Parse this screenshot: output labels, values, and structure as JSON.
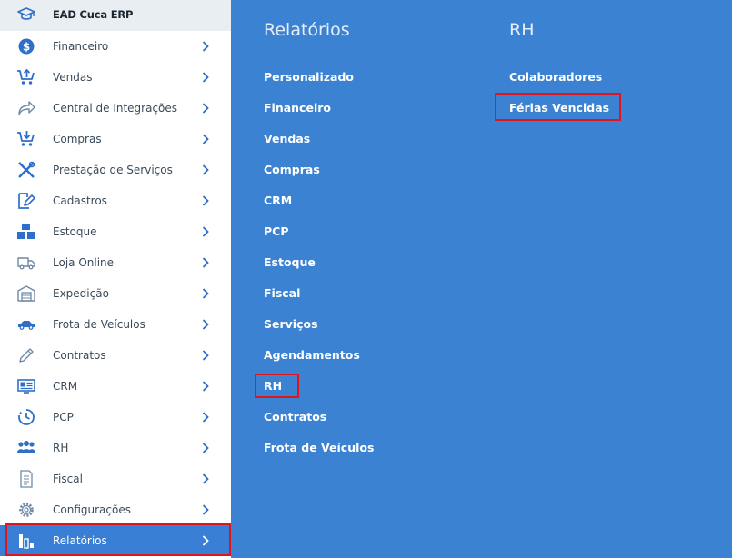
{
  "app": {
    "title": "EAD Cuca ERP",
    "icon": "graduation-cap-icon"
  },
  "colors": {
    "accent": "#3b82d3",
    "active_item": "#3a7fd6",
    "highlight": "#e0141b",
    "icon": "#2f6fc7"
  },
  "sidebar": {
    "items": [
      {
        "label": "Financeiro",
        "icon": "dollar-icon"
      },
      {
        "label": "Vendas",
        "icon": "cart-up-icon"
      },
      {
        "label": "Central de Integrações",
        "icon": "share-arrow-icon"
      },
      {
        "label": "Compras",
        "icon": "cart-down-icon"
      },
      {
        "label": "Prestação de Serviços",
        "icon": "tools-icon"
      },
      {
        "label": "Cadastros",
        "icon": "edit-icon"
      },
      {
        "label": "Estoque",
        "icon": "boxes-icon"
      },
      {
        "label": "Loja Online",
        "icon": "truck-icon"
      },
      {
        "label": "Expedição",
        "icon": "warehouse-icon"
      },
      {
        "label": "Frota de Veículos",
        "icon": "car-icon"
      },
      {
        "label": "Contratos",
        "icon": "pen-icon"
      },
      {
        "label": "CRM",
        "icon": "id-card-icon"
      },
      {
        "label": "PCP",
        "icon": "clock-icon"
      },
      {
        "label": "RH",
        "icon": "users-icon"
      },
      {
        "label": "Fiscal",
        "icon": "document-icon"
      },
      {
        "label": "Configurações",
        "icon": "gear-icon"
      },
      {
        "label": "Relatórios",
        "icon": "bar-chart-icon",
        "active": true
      }
    ]
  },
  "panel": {
    "reports": {
      "title": "Relatórios",
      "links": [
        "Personalizado",
        "Financeiro",
        "Vendas",
        "Compras",
        "CRM",
        "PCP",
        "Estoque",
        "Fiscal",
        "Serviços",
        "Agendamentos",
        "RH",
        "Contratos",
        "Frota de Veículos"
      ],
      "selected": "RH"
    },
    "rh": {
      "title": "RH",
      "links": [
        "Colaboradores",
        "Férias Vencidas"
      ],
      "selected": "Férias Vencidas"
    }
  }
}
